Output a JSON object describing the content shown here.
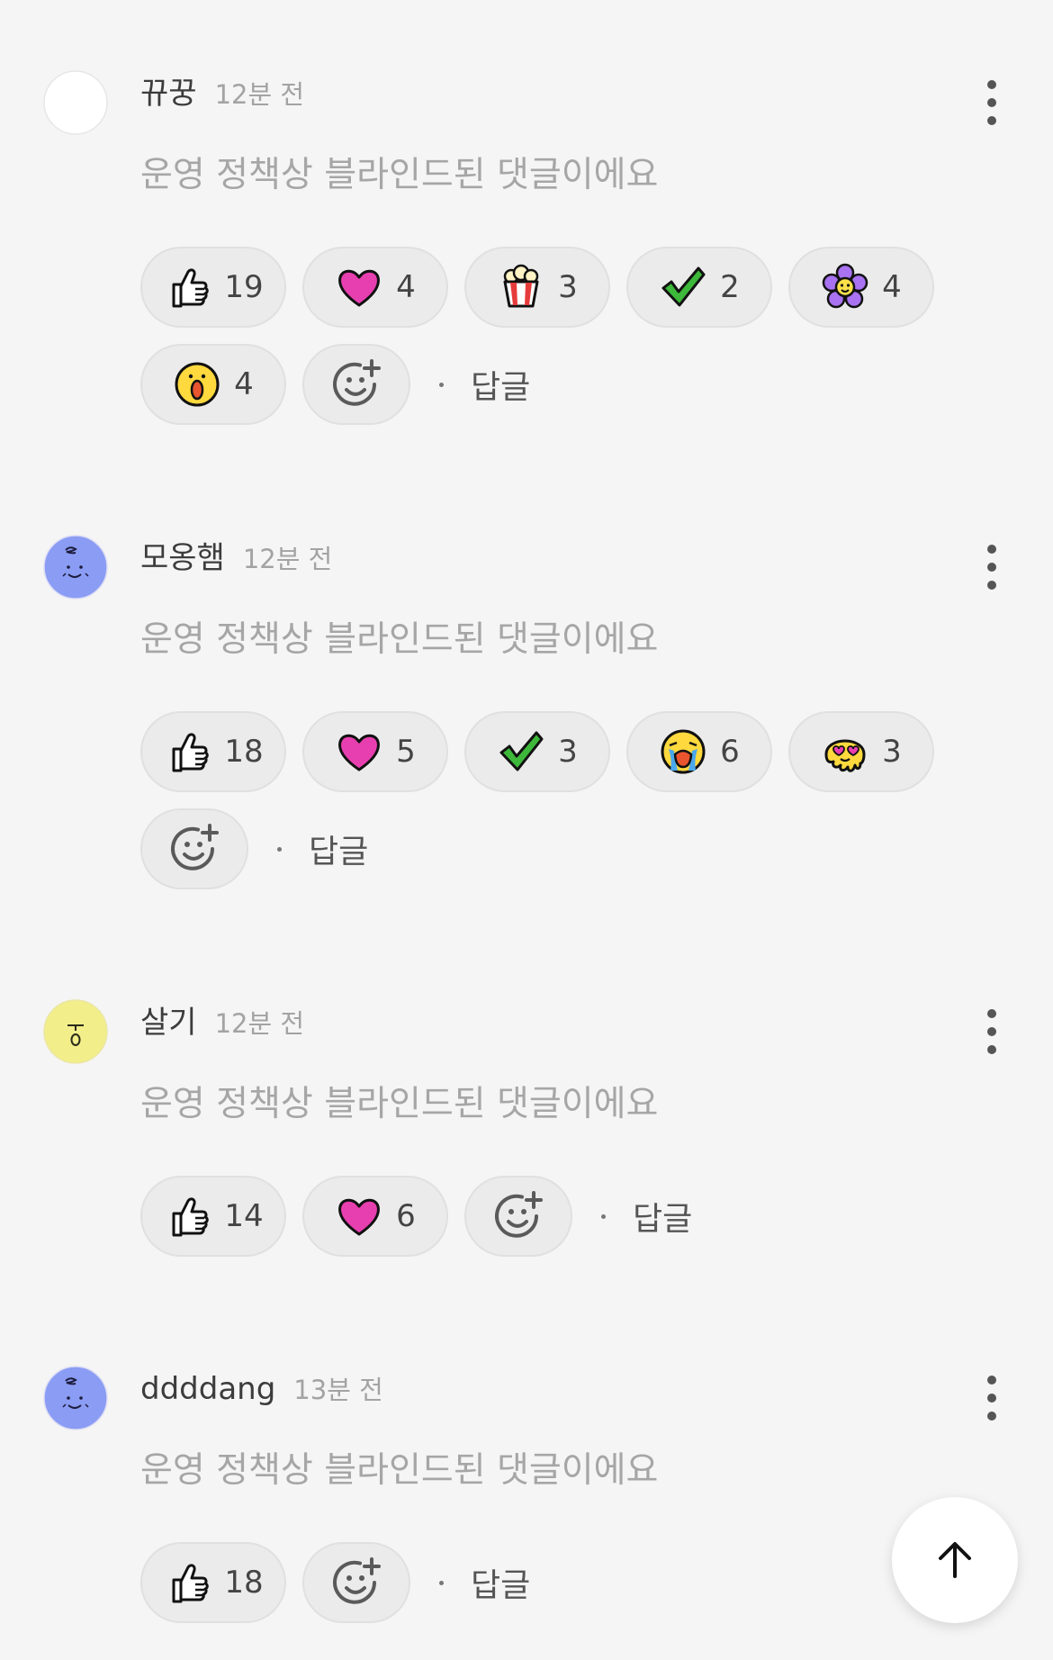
{
  "comments": [
    {
      "author": "뀨꿍",
      "time": "12분 전",
      "text": "운영 정책상 블라인드된 댓글이에요",
      "avatar": "blank",
      "reactions": [
        {
          "icon": "thumbs-up",
          "count": "19"
        },
        {
          "icon": "heart",
          "count": "4"
        },
        {
          "icon": "popcorn",
          "count": "3"
        },
        {
          "icon": "check",
          "count": "2"
        },
        {
          "icon": "flower",
          "count": "4"
        },
        {
          "icon": "surprised",
          "count": "4"
        }
      ],
      "reply_label": "답글"
    },
    {
      "author": "모옹햄",
      "time": "12분 전",
      "text": "운영 정책상 블라인드된 댓글이에요",
      "avatar": "blue-face",
      "reactions": [
        {
          "icon": "thumbs-up",
          "count": "18"
        },
        {
          "icon": "heart",
          "count": "5"
        },
        {
          "icon": "check",
          "count": "3"
        },
        {
          "icon": "crying",
          "count": "6"
        },
        {
          "icon": "melting-love",
          "count": "3"
        }
      ],
      "reply_label": "답글"
    },
    {
      "author": "살기",
      "time": "12분 전",
      "text": "운영 정책상 블라인드된 댓글이에요",
      "avatar": "yellow-face",
      "reactions": [
        {
          "icon": "thumbs-up",
          "count": "14"
        },
        {
          "icon": "heart",
          "count": "6"
        }
      ],
      "reply_label": "답글"
    },
    {
      "author": "ddddang",
      "time": "13분 전",
      "text": "운영 정책상 블라인드된 댓글이에요",
      "avatar": "blue-face",
      "reactions": [
        {
          "icon": "thumbs-up",
          "count": "18"
        }
      ],
      "reply_label": "답글"
    }
  ],
  "icons": {
    "more": "more-vertical-icon",
    "add_reaction": "add-emoji-icon",
    "scroll_top": "arrow-up-icon"
  },
  "colors": {
    "background": "#f5f5f5",
    "pill": "#ebebeb",
    "heart": "#e83fb0",
    "check": "#3db83a",
    "avatar_blue": "#8a9cf3",
    "avatar_yellow": "#f2ee8a"
  }
}
